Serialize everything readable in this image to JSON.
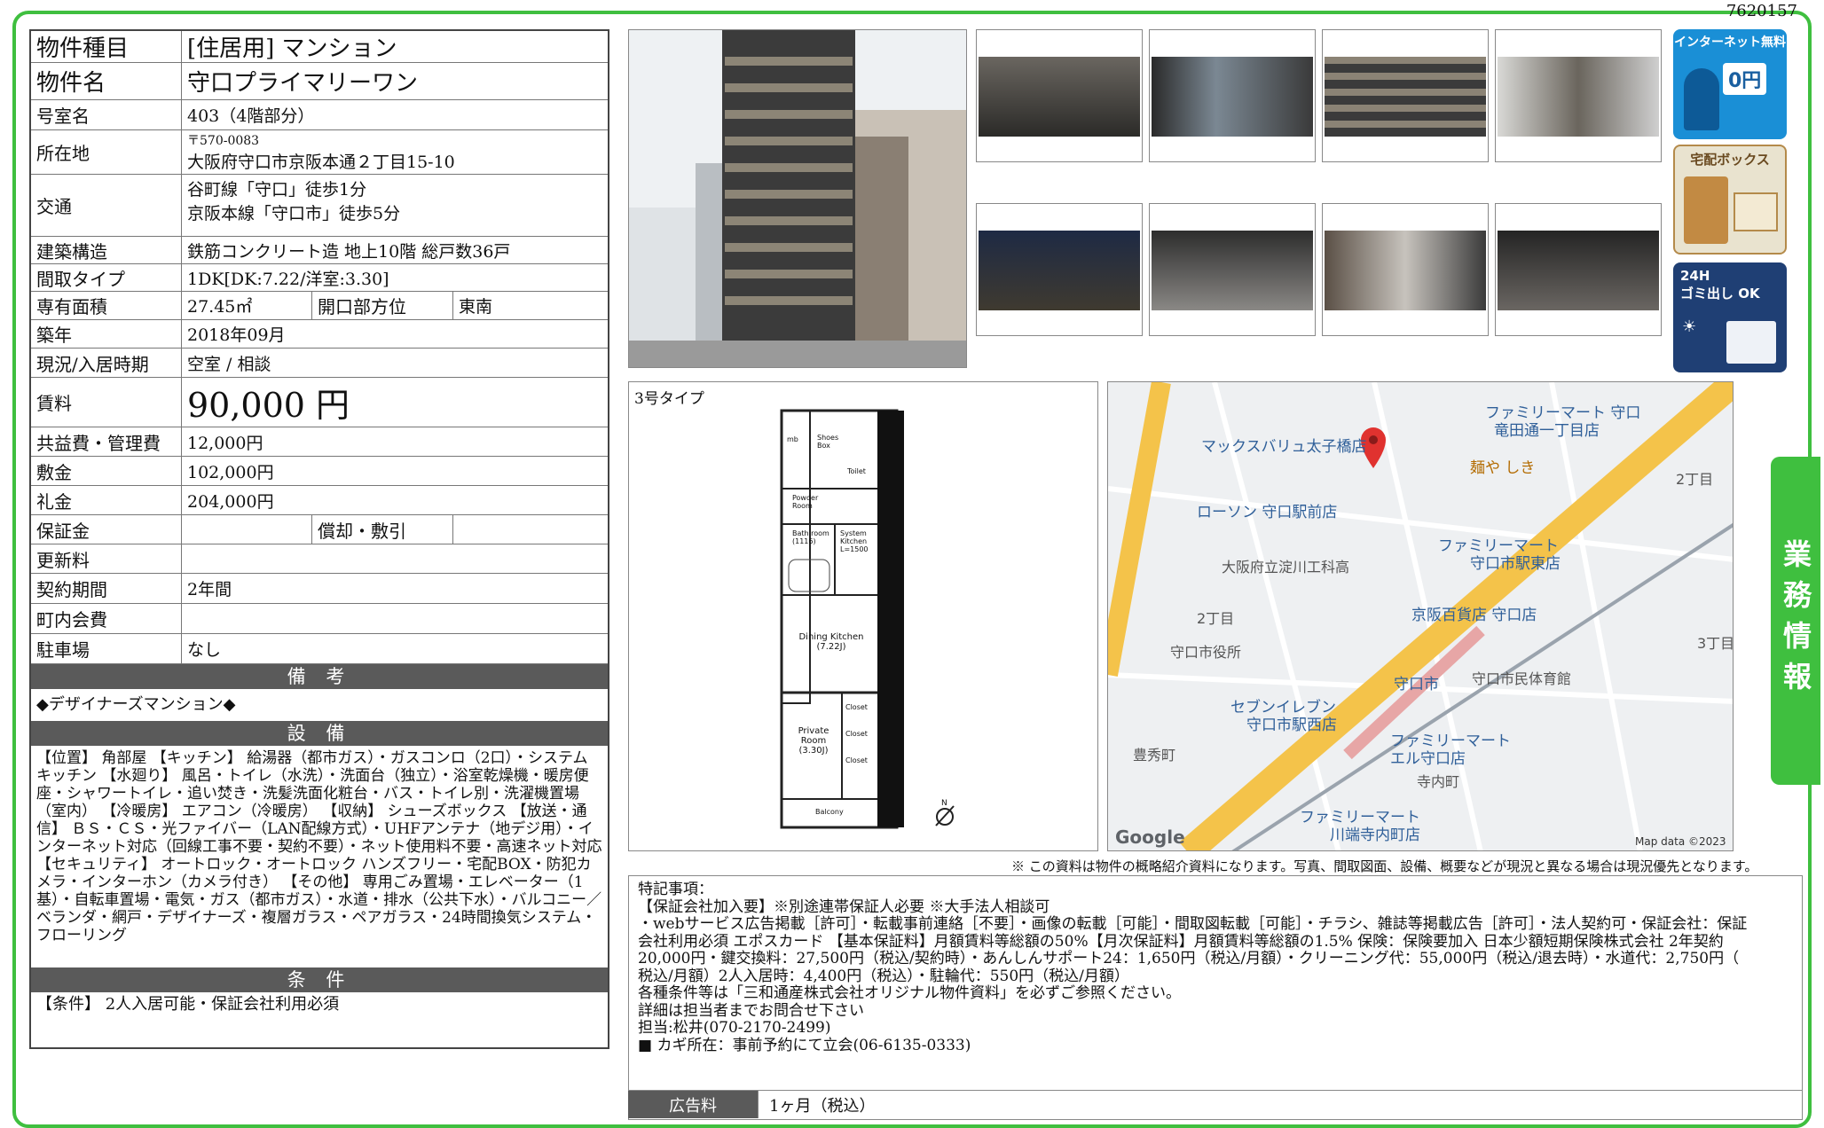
{
  "doc_id": "7620157",
  "spec": {
    "type_label": "物件種目",
    "type_value": "[住居用]  マンション",
    "name_label": "物件名",
    "name_value": "守口プライマリーワン",
    "room_label": "号室名",
    "room_value": "403（4階部分）",
    "addr_label": "所在地",
    "postal": "〒570-0083",
    "address": "大阪府守口市京阪本通２丁目15-10",
    "transit_label": "交通",
    "transit_1": "谷町線「守口」徒歩1分",
    "transit_2": "京阪本線「守口市」徒歩5分",
    "structure_label": "建築構造",
    "structure_value": "鉄筋コンクリート造 地上10階 総戸数36戸",
    "layout_label": "間取タイプ",
    "layout_value": "1DK[DK:7.22/洋室:3.30]",
    "area_label": "専有面積",
    "area_value": "27.45㎡",
    "direction_label": "開口部方位",
    "direction_value": "東南",
    "built_label": "築年",
    "built_value": "2018年09月",
    "status_label": "現況/入居時期",
    "status_value": "空室 /  相談",
    "rent_label": "賃料",
    "rent_value": "90,000 円",
    "fee_label": "共益費・管理費",
    "fee_value": "12,000円",
    "deposit_label": "敷金",
    "deposit_value": "102,000円",
    "key_label": "礼金",
    "key_value": "204,000円",
    "guarantee_label": "保証金",
    "guarantee_value": "",
    "amort_label": "償却・敷引",
    "amort_value": "",
    "renew_label": "更新料",
    "renew_value": "",
    "term_label": "契約期間",
    "term_value": "2年間",
    "assoc_label": "町内会費",
    "assoc_value": "",
    "parking_label": "駐車場",
    "parking_value": "なし"
  },
  "sections": {
    "remarks_title": "備 考",
    "remarks_text": "◆デザイナーズマンション◆",
    "equipment_title": "設 備",
    "equipment_text": "【位置】 角部屋 【キッチン】 給湯器（都市ガス）・ガスコンロ（2口）・システムキッチン 【水廻り】 風呂・トイレ（水洗）・洗面台（独立）・浴室乾燥機・暖房便座・シャワートイレ・追い焚き・洗髪洗面化粧台・バス・トイレ別・洗濯機置場（室内） 【冷暖房】 エアコン（冷暖房） 【収納】 シューズボックス 【放送・通信】 ＢＳ・ＣＳ・光ファイバー（LAN配線方式）・UHFアンテナ（地デジ用）・インターネット対応（回線工事不要・契約不要）・ネット使用料不要・高速ネット対応 【セキュリティ】 オートロック・オートロック ハンズフリー・宅配BOX・防犯カメラ・インターホン（カメラ付き） 【その他】 専用ごみ置場・エレベーター（1基）・自転車置場・電気・ガス（都市ガス）・水道・排水（公共下水）・バルコニー／ベランダ・網戸・デザイナーズ・複層ガラス・ペアガラス・24時間換気システム・フローリング",
    "conditions_title": "条 件",
    "conditions_text": "【条件】 2人入居可能・保証会社利用必須"
  },
  "badges": {
    "internet_title": "インターネット無料",
    "internet_price": "0円",
    "delivery_title": "宅配ボックス",
    "trash_title_1": "24H",
    "trash_title_2": "ゴミ出し OK"
  },
  "floorplan": {
    "type_label": "3号タイプ",
    "rooms": [
      "Shoes Box",
      "mb",
      "Powder Room",
      "Toilet",
      "Bath room (1116)",
      "System Kitchen L=1500",
      "Dining Kitchen (7.22J)",
      "Private Room (3.30J)",
      "Closet",
      "Closet",
      "Closet",
      "Balcony"
    ],
    "compass": "N"
  },
  "map": {
    "labels": [
      "ファミリーマート 守口",
      "竜田通一丁目店",
      "マックスバリュ太子橋店",
      "麺や しき",
      "ローソン 守口駅前店",
      "2丁目",
      "ファミリーマート",
      "守口市駅東店",
      "大阪府立淀川工科高",
      "2丁目",
      "京阪百貨店 守口店",
      "守口市役所",
      "3丁目",
      "守口市",
      "守口市民体育館",
      "セブンイレブン",
      "守口市駅西店",
      "ファミリーマート",
      "エル守口店",
      "豊秀町",
      "寺内町",
      "ファミリーマート",
      "川端寺内町店"
    ],
    "google": "Google",
    "attribution": "Map data ©2023"
  },
  "note": "※ この資料は物件の概略紹介資料になります。写真、間取図面、設備、概要などが現況と異なる場合は現況優先となります。",
  "special": {
    "lines": [
      "特記事項：",
      "【保証会社加入要】※別途連帯保証人必要 ※大手法人相談可",
      "・webサービス広告掲載［許可］・転載事前連絡［不要］・画像の転載［可能］・間取図転載［可能］・チラシ、雑誌等掲載広告［許可］・法人契約可・保証会社：保証",
      "会社利用必須 エポスカード 【基本保証料】月額賃料等総額の50%【月次保証料】月額賃料等総額の1.5% 保険：保険要加入 日本少額短期保険株式会社 2年契約",
      "20,000円・鍵交換料：27,500円（税込/契約時）・あんしんサポート24：1,650円（税込/月額）・クリーニング代：55,000円（税込/退去時）・水道代：2,750円（",
      "税込/月額）2人入居時：4,400円（税込）・駐輪代：550円（税込/月額）",
      "各種条件等は「三和通産株式会社オリジナル物件資料」を必ずご参照ください。",
      "詳細は担当者までお問合せ下さい",
      "担当:松井(070-2170-2499)",
      "■ カギ所在：事前予約にて立会(06-6135-0333)"
    ],
    "ad_label": "広告料",
    "ad_value": "1ヶ月（税込）"
  },
  "side_tab": "業務情報"
}
